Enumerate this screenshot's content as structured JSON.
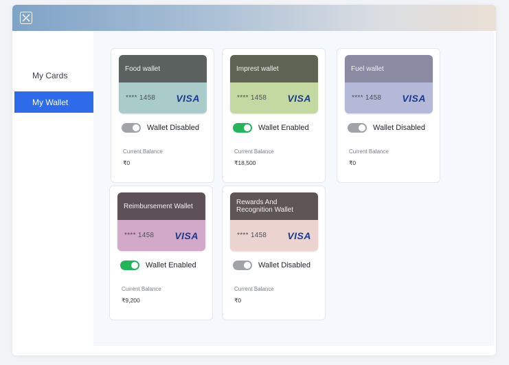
{
  "sidebar": {
    "items": [
      {
        "label": "My Cards",
        "active": false
      },
      {
        "label": "My Wallet",
        "active": true
      }
    ]
  },
  "wallets": [
    {
      "name": "Food wallet",
      "masked_number": "**** 1458",
      "network": "VISA",
      "status": "Wallet Disabled",
      "enabled": false,
      "balance_label": "Current Balance",
      "balance": "₹0",
      "top_color": "#5a615f",
      "bottom_color": "#a9cccb"
    },
    {
      "name": "Imprest wallet",
      "masked_number": "**** 1458",
      "network": "VISA",
      "status": "Wallet Enabled",
      "enabled": true,
      "balance_label": "Current Balance",
      "balance": "₹18,500",
      "top_color": "#5f6353",
      "bottom_color": "#c4d8a2"
    },
    {
      "name": "Fuel wallet",
      "masked_number": "**** 1458",
      "network": "VISA",
      "status": "Wallet Disabled",
      "enabled": false,
      "balance_label": "Current Balance",
      "balance": "₹0",
      "top_color": "#8a8aa3",
      "bottom_color": "#b4b9d8"
    },
    {
      "name": "Reimbursement Wallet",
      "masked_number": "**** 1458",
      "network": "VISA",
      "status": "Wallet Enabled",
      "enabled": true,
      "balance_label": "Current Balance",
      "balance": "₹9,200",
      "top_color": "#5d5057",
      "bottom_color": "#d3a9c9"
    },
    {
      "name": "Rewards And Recognition Wallet",
      "masked_number": "**** 1458",
      "network": "VISA",
      "status": "Wallet Disabled",
      "enabled": false,
      "balance_label": "Current Balance",
      "balance": "₹0",
      "top_color": "#5e5654",
      "bottom_color": "#ebd3d0"
    }
  ],
  "colors": {
    "accent": "#2d6bea",
    "toggle_on": "#22b55a",
    "toggle_off": "#a0a4a8"
  },
  "icons": {
    "logo": "app-logo-icon"
  }
}
